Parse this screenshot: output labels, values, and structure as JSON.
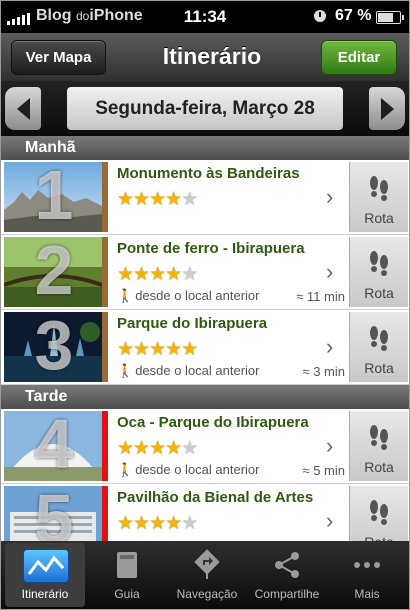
{
  "status_bar": {
    "carrier": "Blog",
    "carrier_small": "do",
    "carrier_rest": "iPhone",
    "time": "11:34",
    "battery": "67 %"
  },
  "nav": {
    "left_button": "Ver Mapa",
    "title": "Itinerário",
    "right_button": "Editar"
  },
  "date_bar": {
    "label": "Segunda-feira, Março 28"
  },
  "sections": [
    {
      "label": "Manhã"
    },
    {
      "label": "Tarde"
    }
  ],
  "items": [
    {
      "number": "1",
      "title": "Monumento às Bandeiras",
      "rating": 4,
      "walk": "",
      "distance": "",
      "route_label": "Rota",
      "marker_color": "#9a6a32"
    },
    {
      "number": "2",
      "title": "Ponte de ferro - Ibirapuera",
      "rating": 4,
      "walk": "desde o local anterior",
      "distance": "≈ 11 min",
      "route_label": "Rota",
      "marker_color": "#9a6a32"
    },
    {
      "number": "3",
      "title": "Parque do Ibirapuera",
      "rating": 5,
      "walk": "desde o local anterior",
      "distance": "≈ 3 min",
      "route_label": "Rota",
      "marker_color": "#9a6a32"
    },
    {
      "number": "4",
      "title": "Oca - Parque do Ibirapuera",
      "rating": 4,
      "walk": "desde o local anterior",
      "distance": "≈ 5 min",
      "route_label": "Rota",
      "marker_color": "#e01212"
    },
    {
      "number": "5",
      "title": "Pavilhão da Bienal de Artes",
      "rating": 4,
      "walk": "",
      "distance": "",
      "route_label": "Rota",
      "marker_color": "#e01212"
    }
  ],
  "tabs": [
    {
      "label": "Itinerário",
      "icon": "chart-icon",
      "active": true
    },
    {
      "label": "Guia",
      "icon": "book-icon",
      "active": false
    },
    {
      "label": "Navegação",
      "icon": "turn-sign-icon",
      "active": false
    },
    {
      "label": "Compartilhe",
      "icon": "share-icon",
      "active": false
    },
    {
      "label": "Mais",
      "icon": "more-icon",
      "active": false
    }
  ]
}
